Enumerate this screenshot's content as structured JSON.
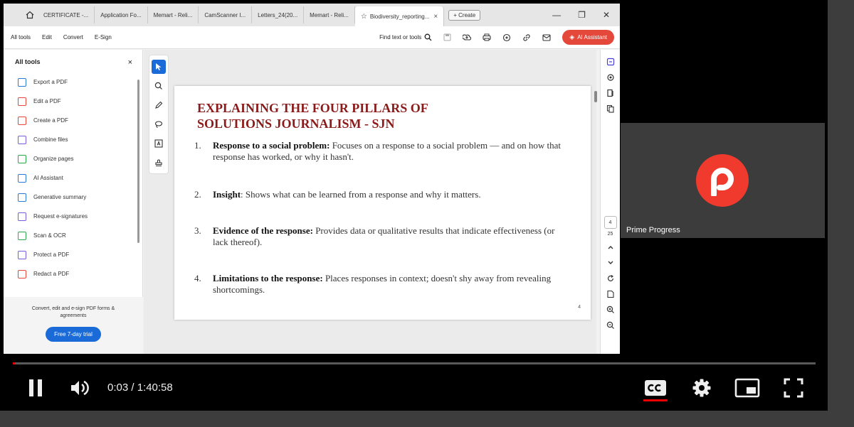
{
  "browser": {
    "tabs": [
      {
        "label": "CERTIFICATE -..."
      },
      {
        "label": "Application Fo..."
      },
      {
        "label": "Memart - Reli..."
      },
      {
        "label": "CamScanner I..."
      },
      {
        "label": "Letters_24(20..."
      },
      {
        "label": "Memart - Reli..."
      },
      {
        "label": "Biodiversity_reporting..."
      }
    ],
    "new_tab_label": "+ Create"
  },
  "acrobat": {
    "menu": [
      "All tools",
      "Edit",
      "Convert",
      "E-Sign"
    ],
    "find_label": "Find text or tools",
    "ai_button": "AI Assistant",
    "panel_title": "All tools",
    "tools": [
      {
        "label": "Export a PDF",
        "color": "#2a7bd6"
      },
      {
        "label": "Edit a PDF",
        "color": "#e3483b"
      },
      {
        "label": "Create a PDF",
        "color": "#e3483b"
      },
      {
        "label": "Combine files",
        "color": "#7b5cd6"
      },
      {
        "label": "Organize pages",
        "color": "#2aa84a"
      },
      {
        "label": "AI Assistant",
        "color": "#2a7bd6"
      },
      {
        "label": "Generative summary",
        "color": "#2a7bd6"
      },
      {
        "label": "Request e-signatures",
        "color": "#7b5cd6"
      },
      {
        "label": "Scan & OCR",
        "color": "#2aa84a"
      },
      {
        "label": "Protect a PDF",
        "color": "#7b5cd6"
      },
      {
        "label": "Redact a PDF",
        "color": "#e3483b"
      }
    ],
    "footer_text": "Convert, edit and e-sign PDF forms & agreements",
    "trial_button": "Free 7-day trial",
    "current_page": "4",
    "total_pages": "25"
  },
  "slide": {
    "title": "EXPLAINING THE FOUR PILLARS OF SOLUTIONS JOURNALISM - SJN",
    "points": [
      {
        "num": "1.",
        "head": "Response to a social problem:",
        "text": " Focuses on a response to a social problem — and on how that response has worked, or why it hasn't."
      },
      {
        "num": "2.",
        "head": "Insight",
        "text": ": Shows what can be learned from a response and why it matters."
      },
      {
        "num": "3.",
        "head": "Evidence of the response:",
        "text": " Provides data or qualitative results that indicate effectiveness (or lack thereof)."
      },
      {
        "num": "4.",
        "head": "Limitations to the response:",
        "text": " Places responses in context; doesn't shy away from revealing shortcomings."
      }
    ],
    "page_number": "4"
  },
  "participant": {
    "name": "Prime Progress",
    "avatar_color": "#f03a2e"
  },
  "player": {
    "time": "0:03 / 1:40:58",
    "progress_fraction": 0.0005
  }
}
